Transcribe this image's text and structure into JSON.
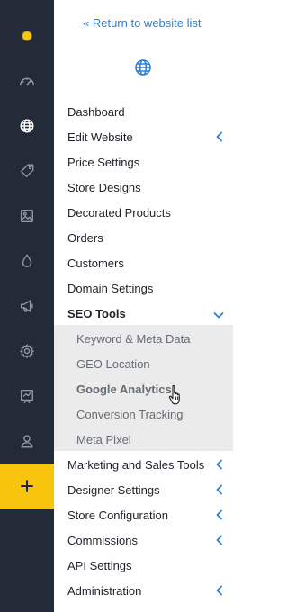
{
  "rail": {
    "items": [
      {
        "name": "status-dot-icon"
      },
      {
        "name": "dashboard-gauge-icon"
      },
      {
        "name": "website-globe-icon"
      },
      {
        "name": "price-tag-icon"
      },
      {
        "name": "image-icon"
      },
      {
        "name": "color-drop-icon"
      },
      {
        "name": "megaphone-icon"
      },
      {
        "name": "settings-gear-icon"
      },
      {
        "name": "presentation-icon"
      },
      {
        "name": "user-icon"
      },
      {
        "name": "plus-icon"
      }
    ],
    "colors": {
      "background": "#232b38",
      "accent": "#f8c50c"
    }
  },
  "panel": {
    "return_link": "« Return to website list",
    "globe_icon": "globe-icon",
    "menu": [
      {
        "label": "Dashboard"
      },
      {
        "label": "Edit Website",
        "chevron": "left"
      },
      {
        "label": "Price Settings"
      },
      {
        "label": "Store Designs"
      },
      {
        "label": "Decorated Products"
      },
      {
        "label": "Orders"
      },
      {
        "label": "Customers"
      },
      {
        "label": "Domain Settings"
      },
      {
        "label": "SEO Tools",
        "chevron": "down",
        "expanded": true
      }
    ],
    "seo_submenu": [
      {
        "label": "Keyword & Meta Data"
      },
      {
        "label": "GEO Location"
      },
      {
        "label": "Google Analytics",
        "hovered": true
      },
      {
        "label": "Conversion Tracking"
      },
      {
        "label": "Meta Pixel"
      }
    ],
    "menu_after": [
      {
        "label": "Marketing and Sales Tools",
        "chevron": "left"
      },
      {
        "label": "Designer Settings",
        "chevron": "left"
      },
      {
        "label": "Store Configuration",
        "chevron": "left"
      },
      {
        "label": "Commissions",
        "chevron": "left"
      },
      {
        "label": "API Settings"
      },
      {
        "label": "Administration",
        "chevron": "left"
      }
    ],
    "colors": {
      "link": "#2f80d6",
      "text": "#1e2229",
      "submenu_bg": "#ebebeb",
      "submenu_text": "#666c74"
    }
  }
}
